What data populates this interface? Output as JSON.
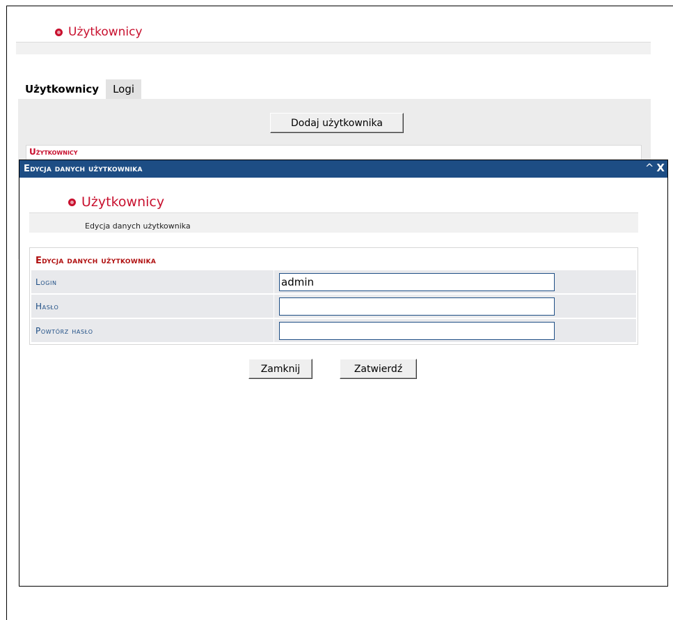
{
  "page": {
    "title": "Użytkownicy"
  },
  "tabs": [
    {
      "label": "Użytkownicy",
      "active": true
    },
    {
      "label": "Logi",
      "active": false
    }
  ],
  "toolbar": {
    "add_user_label": "Dodaj użytkownika"
  },
  "background_table": {
    "caption": "Użytkownicy"
  },
  "dialog": {
    "title": "Edycja danych użytkownika",
    "minimize_symbol": "^",
    "close_symbol": "X",
    "header_title": "Użytkownicy",
    "subtitle": "Edycja danych użytkownika",
    "form": {
      "caption": "Edycja danych użytkownika",
      "fields": [
        {
          "label": "Login",
          "value": "admin"
        },
        {
          "label": "Hasło",
          "value": ""
        },
        {
          "label": "Powtórz hasło",
          "value": ""
        }
      ]
    },
    "buttons": {
      "close_label": "Zamknij",
      "confirm_label": "Zatwierdź"
    }
  },
  "colors": {
    "accent_red": "#c8102e",
    "titlebar_blue": "#1d4d84",
    "label_blue": "#1d4d84"
  }
}
